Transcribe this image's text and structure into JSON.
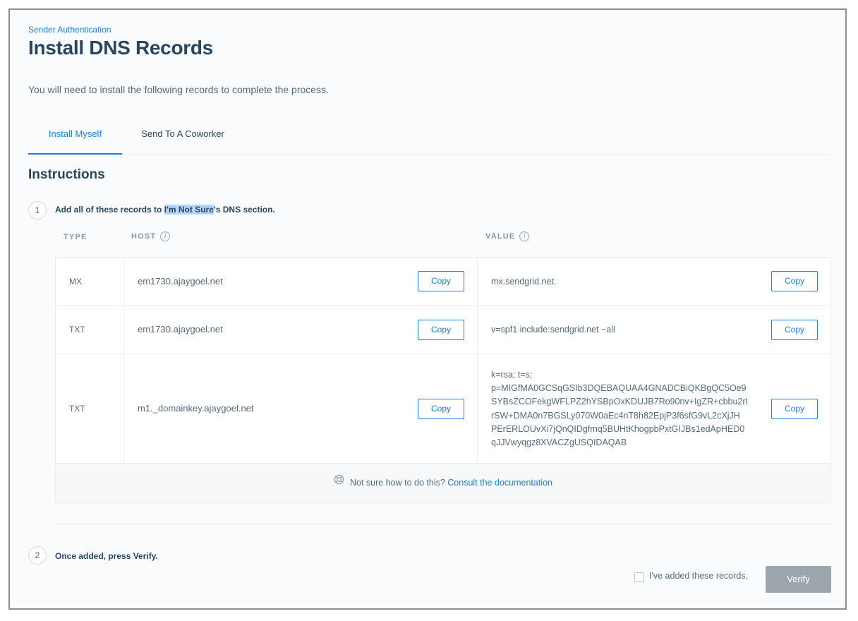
{
  "header": {
    "breadcrumb": "Sender Authentication",
    "title": "Install DNS Records",
    "intro": "You will need to install the following records to complete the process."
  },
  "tabs": [
    {
      "label": "Install Myself",
      "active": true
    },
    {
      "label": "Send To A Coworker",
      "active": false
    }
  ],
  "instructions": {
    "title": "Instructions",
    "step1": {
      "number": "1",
      "text_before": "Add all of these records to ",
      "highlight": "I'm Not Sure",
      "text_after": "'s DNS section."
    },
    "step2": {
      "number": "2",
      "text": "Once added, press Verify."
    }
  },
  "table": {
    "headers": {
      "type": "TYPE",
      "host": "HOST",
      "value": "VALUE"
    },
    "copy_label": "Copy",
    "rows": [
      {
        "type": "MX",
        "host": "em1730.ajaygoel.net",
        "value": "mx.sendgrid.net."
      },
      {
        "type": "TXT",
        "host": "em1730.ajaygoel.net",
        "value": "v=spf1 include:sendgrid.net ~all"
      },
      {
        "type": "TXT",
        "host": "m1._domainkey.ajaygoel.net",
        "value": "k=rsa; t=s; p=MIGfMA0GCSqGSIb3DQEBAQUAA4GNADCBiQKBgQC5Oe9SYBsZCOFekgWFLPZ2hYSBpOxKDUJB7Ro90nv+IgZR+cbbu2rIrSW+DMA0n7BGSLy070W0aEc4nT8h82EpjP3f6sfG9vL2cXjJHPErERLOUvXi7jQnQIDgfmq5BUHtKhogpbPxtGIJBs1edApHED0qJJVwyqgz8XVACZgUSQIDAQAB"
      }
    ],
    "value_lines": [
      "k=rsa; t=s;",
      "p=MIGfMA0GCSqGSIb3DQEBAQUAA4GNADCBiQKBgQC5Oe9",
      "SYBsZCOFekgWFLPZ2hYSBpOxKDUJB7Ro90nv+IgZR+cbbu2rI",
      "rSW+DMA0n7BGSLy070W0aEc4nT8h82EpjP3f6sfG9vL2cXjJH",
      "PErERLOUvXi7jQnQIDgfmq5BUHtKhogpbPxtGIJBs1edApHED0",
      "qJJVwyqgz8XVACZgUSQIDAQAB"
    ],
    "help_text": "Not sure how to do this?",
    "help_link": "Consult the documentation"
  },
  "verify": {
    "checkbox_label": "I've added these records.",
    "checkbox_checked": false,
    "button_label": "Verify"
  },
  "colors": {
    "accent": "#1a82e2",
    "title": "#294661",
    "body_text": "#546b81",
    "verify_disabled": "#9ea6ad"
  }
}
